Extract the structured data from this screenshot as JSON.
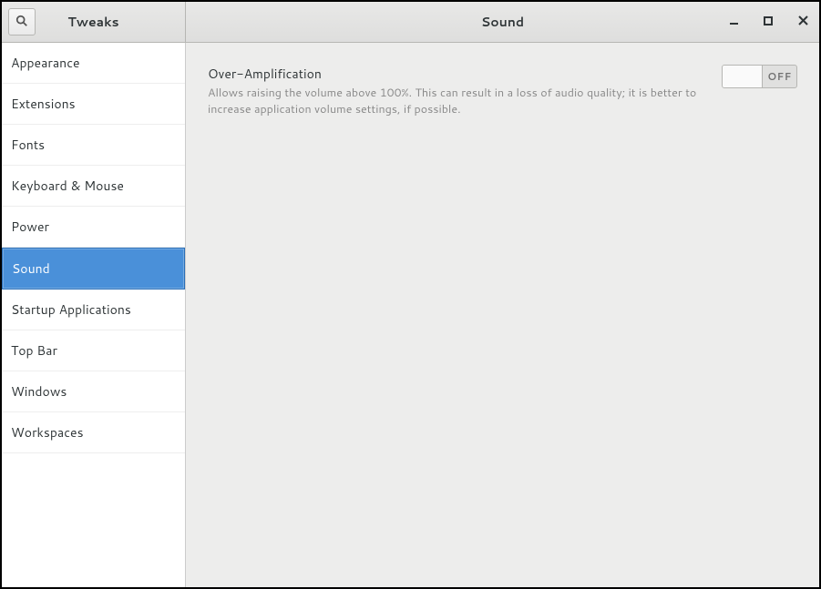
{
  "app_title": "Tweaks",
  "page_title": "Sound",
  "sidebar": {
    "items": [
      {
        "label": "Appearance",
        "selected": false
      },
      {
        "label": "Extensions",
        "selected": false
      },
      {
        "label": "Fonts",
        "selected": false
      },
      {
        "label": "Keyboard & Mouse",
        "selected": false
      },
      {
        "label": "Power",
        "selected": false
      },
      {
        "label": "Sound",
        "selected": true
      },
      {
        "label": "Startup Applications",
        "selected": false
      },
      {
        "label": "Top Bar",
        "selected": false
      },
      {
        "label": "Windows",
        "selected": false
      },
      {
        "label": "Workspaces",
        "selected": false
      }
    ]
  },
  "content": {
    "over_amp_title": "Over-Amplification",
    "over_amp_desc": "Allows raising the volume above 100%. This can result in a loss of audio quality; it is better to increase application volume settings, if possible.",
    "over_amp_switch_state_label": "OFF",
    "over_amp_switch_on": false
  }
}
